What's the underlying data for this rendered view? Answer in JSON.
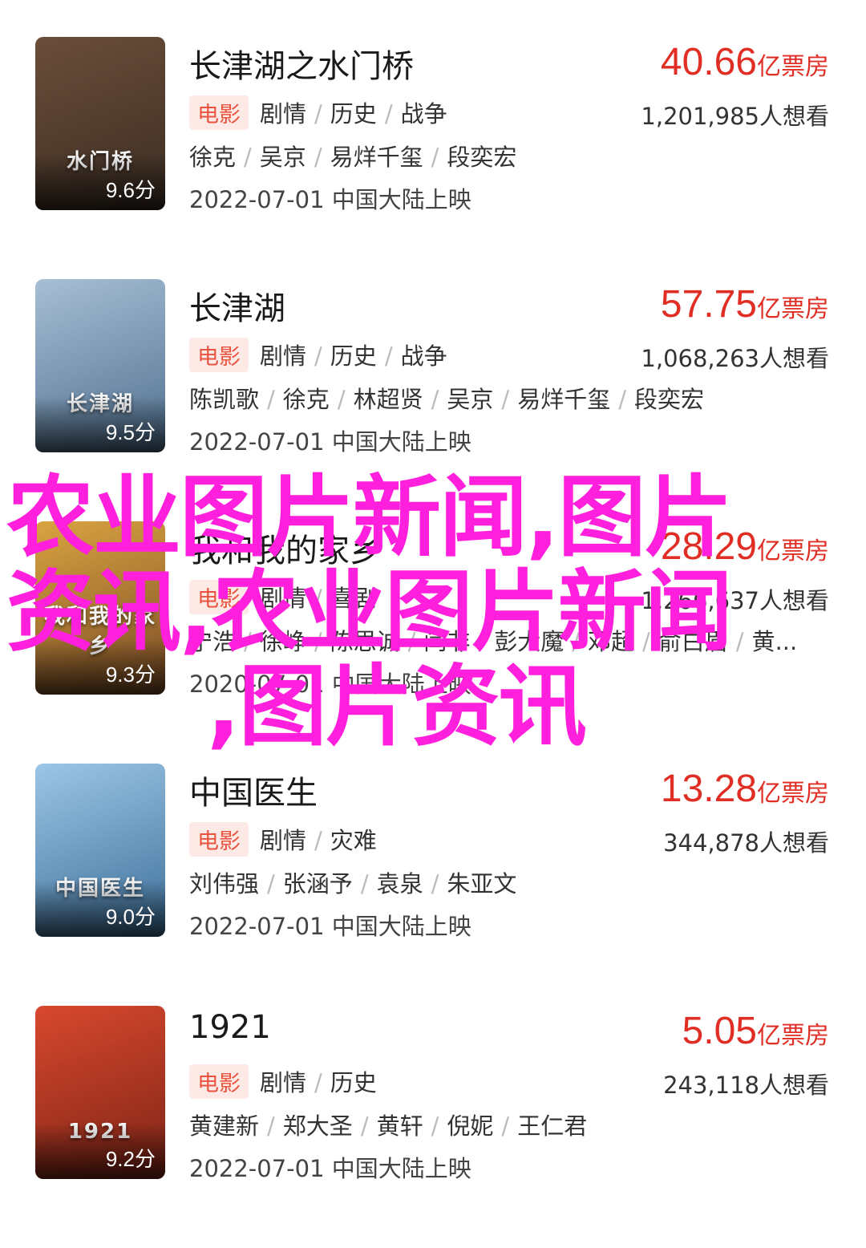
{
  "movies": [
    {
      "title": "长津湖之水门桥",
      "box_num": "40.66",
      "box_unit": "亿票房",
      "type_tag": "电影",
      "genres": [
        "剧情",
        "历史",
        "战争"
      ],
      "wish": "1,201,985人想看",
      "cast": [
        "徐克",
        "吴京",
        "易烊千玺",
        "段奕宏"
      ],
      "release": "2022-07-01 中国大陆上映",
      "score": "9.6分",
      "poster_text": "水门桥",
      "poster_colors": [
        "#6b4e3a",
        "#3a2c22"
      ]
    },
    {
      "title": "长津湖",
      "box_num": "57.75",
      "box_unit": "亿票房",
      "type_tag": "电影",
      "genres": [
        "剧情",
        "历史",
        "战争"
      ],
      "wish": "1,068,263人想看",
      "cast": [
        "陈凯歌",
        "徐克",
        "林超贤",
        "吴京",
        "易烊千玺",
        "段奕宏"
      ],
      "release": "2022-07-01 中国大陆上映",
      "score": "9.5分",
      "poster_text": "长津湖",
      "poster_colors": [
        "#a7bfd6",
        "#4f6f8e"
      ]
    },
    {
      "title": "我和我的家乡",
      "box_num": "28.29",
      "box_unit": "亿票房",
      "type_tag": "电影",
      "genres": [
        "剧情",
        "喜剧"
      ],
      "wish": "1,266,637人想看",
      "cast": [
        "宁浩",
        "徐峥",
        "陈思诚",
        "闫非",
        "彭大魔",
        "邓超",
        "俞白眉",
        "黄..."
      ],
      "release": "2020-07-01 中国大陆上映",
      "score": "9.3分",
      "poster_text": "我和我的家乡",
      "poster_colors": [
        "#d9a441",
        "#7a4b26"
      ]
    },
    {
      "title": "中国医生",
      "box_num": "13.28",
      "box_unit": "亿票房",
      "type_tag": "电影",
      "genres": [
        "剧情",
        "灾难"
      ],
      "wish": "344,878人想看",
      "cast": [
        "刘伟强",
        "张涵予",
        "袁泉",
        "朱亚文"
      ],
      "release": "2022-07-01 中国大陆上映",
      "score": "9.0分",
      "poster_text": "中国医生",
      "poster_colors": [
        "#9cc6e6",
        "#3c6e98"
      ]
    },
    {
      "title": "1921",
      "box_num": "5.05",
      "box_unit": "亿票房",
      "type_tag": "电影",
      "genres": [
        "剧情",
        "历史"
      ],
      "wish": "243,118人想看",
      "cast": [
        "黄建新",
        "郑大圣",
        "黄轩",
        "倪妮",
        "王仁君"
      ],
      "release": "2022-07-01 中国大陆上映",
      "score": "9.2分",
      "poster_text": "1921",
      "poster_colors": [
        "#d8482e",
        "#7d2416"
      ]
    }
  ],
  "watermark": {
    "lines": [
      "农业图片新闻,图片",
      "资讯,农业图片新闻",
      ",图片资讯"
    ]
  },
  "colors": {
    "accent_red": "#e02e24",
    "tag_bg": "#fdeae6",
    "watermark": "#ff1fdc"
  }
}
